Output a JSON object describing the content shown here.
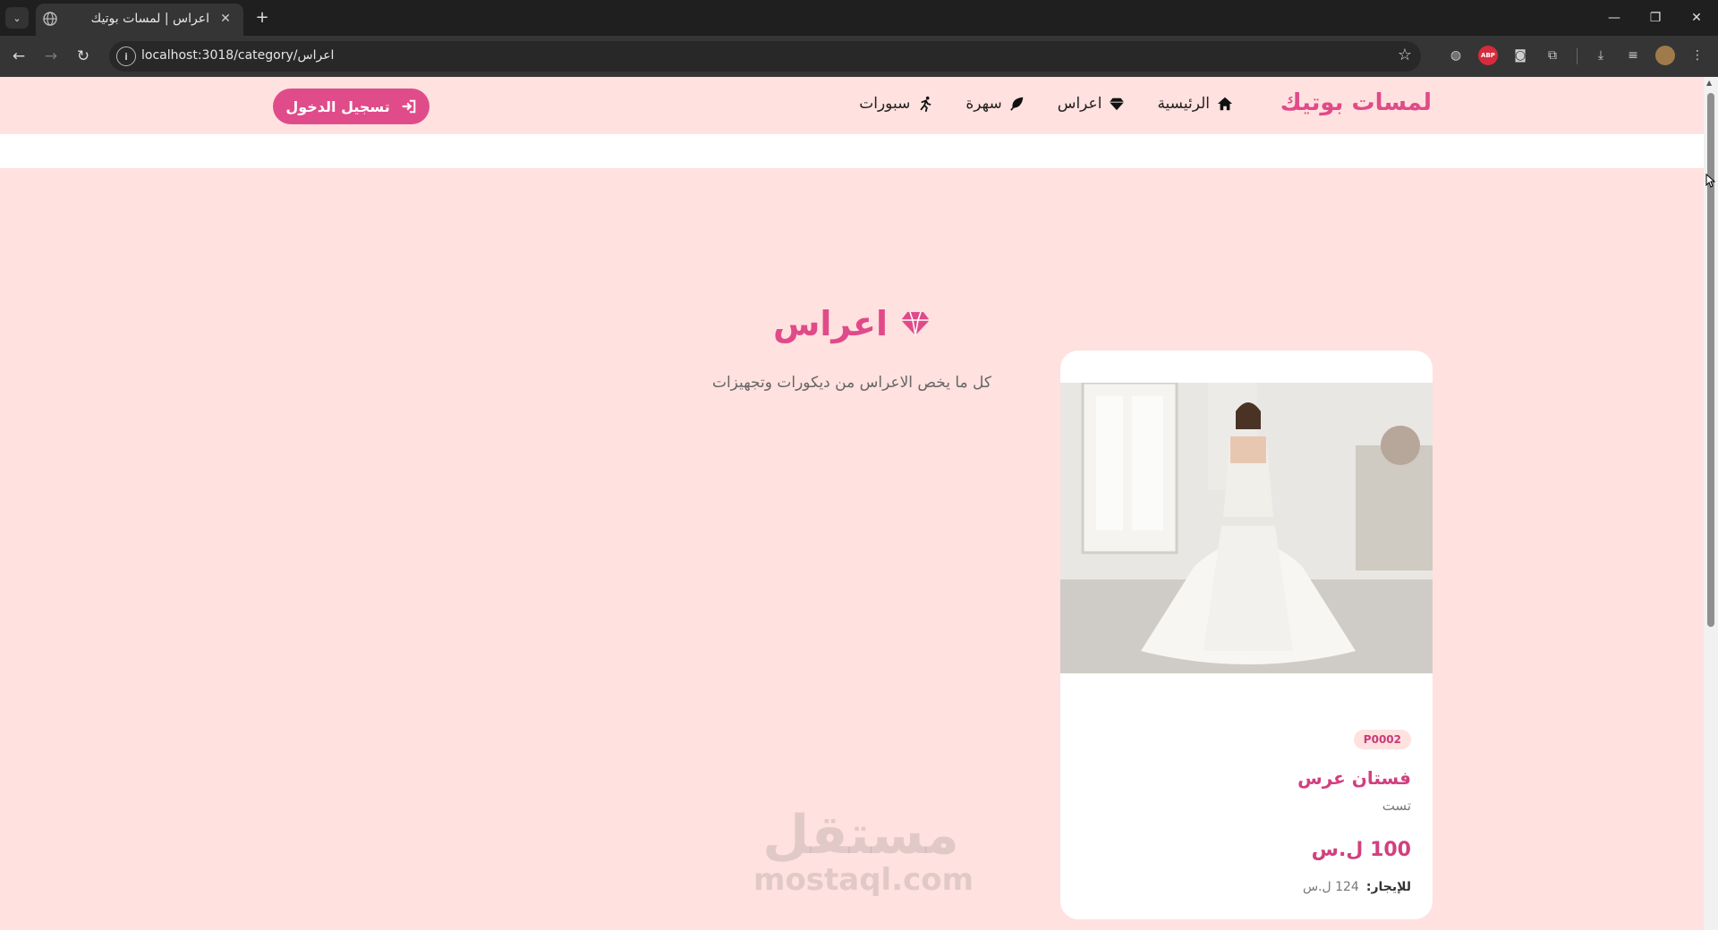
{
  "browser": {
    "tab_title": "اعراس | لمسات بوتيك",
    "tab_close": "✕",
    "new_tab": "+",
    "url": "localhost:3018/category/اعراس",
    "window": {
      "minimize": "—",
      "restore": "❐",
      "close": "✕"
    }
  },
  "header": {
    "brand": "لمسات بوتيك",
    "nav": [
      {
        "label": "الرئيسية",
        "icon": "home-icon"
      },
      {
        "label": "اعراس",
        "icon": "diamond-icon"
      },
      {
        "label": "سهرة",
        "icon": "leaf-icon"
      },
      {
        "label": "سبورات",
        "icon": "running-icon"
      }
    ],
    "login_label": "تسجيل الدخول"
  },
  "hero": {
    "title": "اعراس",
    "subtitle": "كل ما يخص الاعراس من ديكورات وتجهيزات"
  },
  "product": {
    "sku": "P0002",
    "name": "فستان عرس",
    "description": "تست",
    "price": "100 ل.س",
    "rent_label": "للإيجار:",
    "rent_value": "124 ل.س"
  },
  "watermark": {
    "arabic": "مستقل",
    "latin": "mostaql.com"
  },
  "colors": {
    "accent": "#e04c8a",
    "page_bg": "#ffe1df",
    "card_bg": "#ffffff"
  }
}
